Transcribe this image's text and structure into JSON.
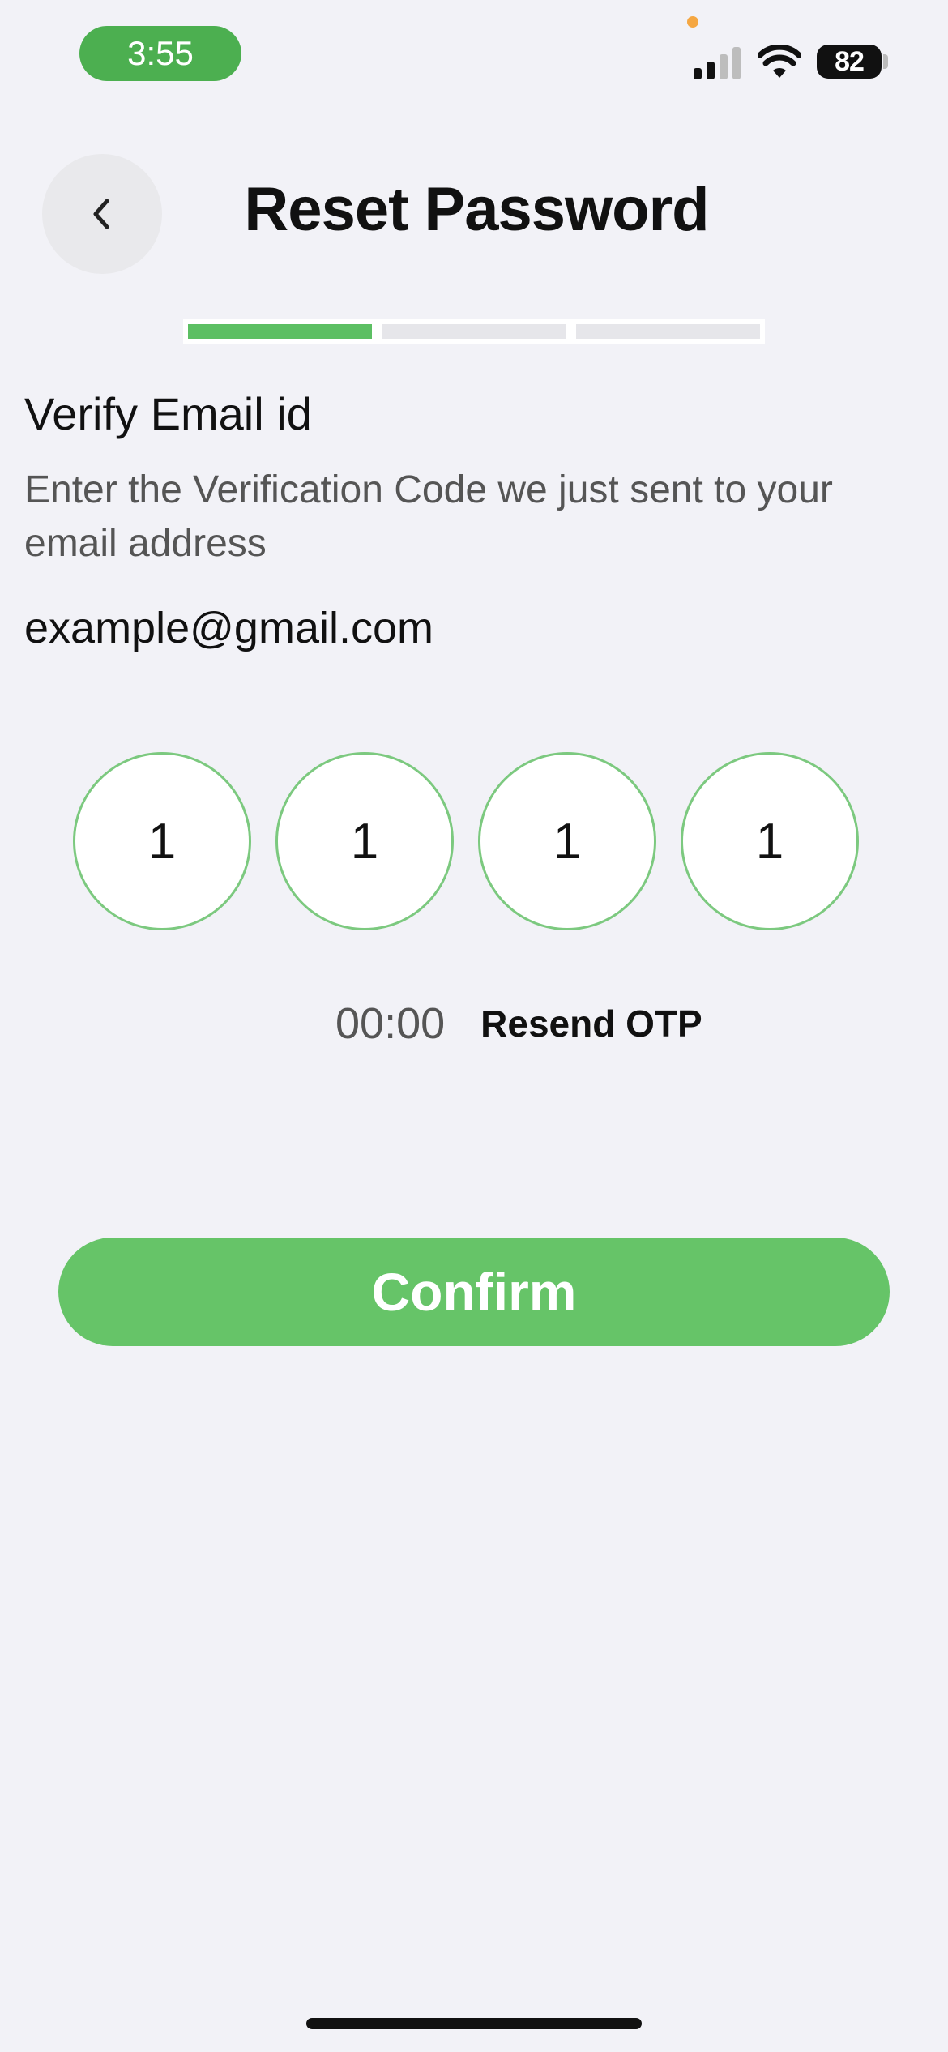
{
  "status_bar": {
    "time": "3:55",
    "battery": "82"
  },
  "header": {
    "title": "Reset Password"
  },
  "progress": {
    "total_steps": 3,
    "current_step": 1
  },
  "verify": {
    "title": "Verify Email id",
    "description": "Enter the Verification Code we just sent to your email address",
    "email": "example@gmail.com"
  },
  "otp": {
    "digits": [
      "1",
      "1",
      "1",
      "1"
    ],
    "timer": "00:00",
    "resend_label": "Resend OTP"
  },
  "actions": {
    "confirm_label": "Confirm"
  },
  "colors": {
    "accent": "#66c468",
    "background": "#f2f2f7"
  }
}
